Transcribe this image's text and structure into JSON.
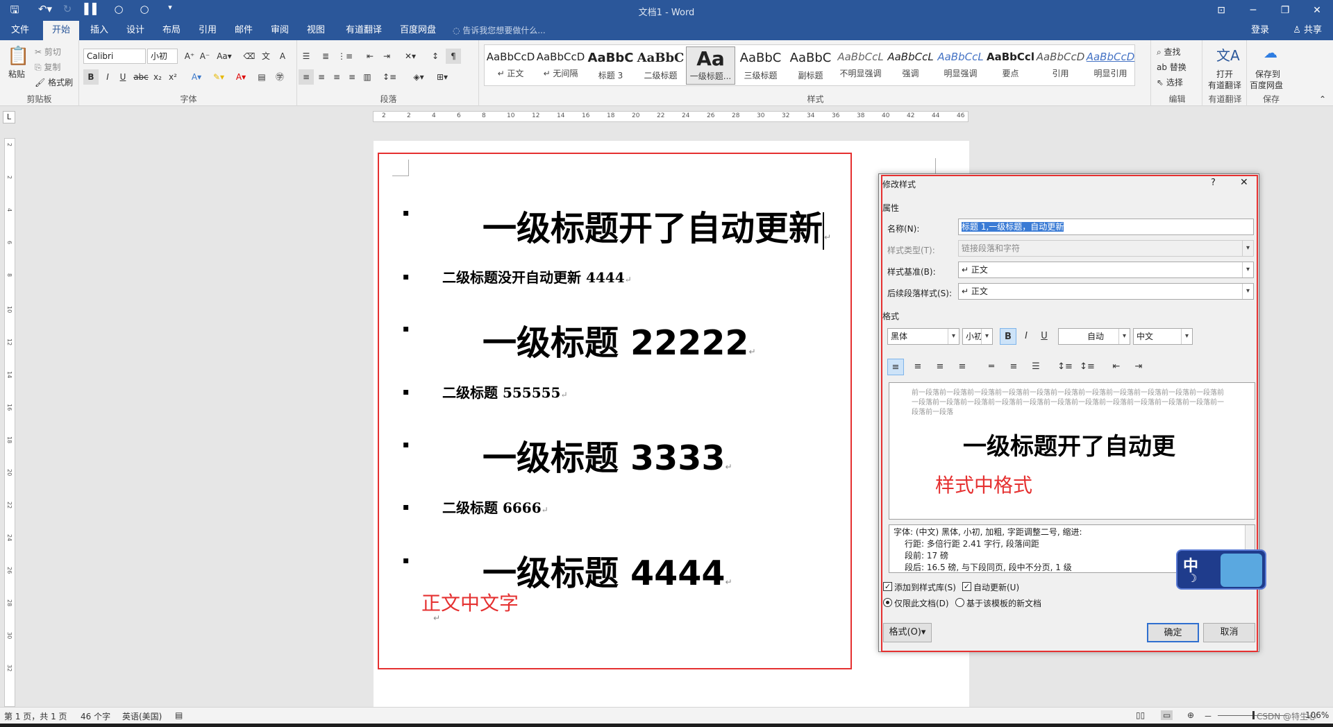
{
  "titlebar": {
    "title": "文档1 - Word",
    "qa_icons": [
      "save-icon",
      "undo-icon",
      "redo-icon",
      "chart-icon",
      "circle-icon",
      "circle-icon",
      "customize-icon"
    ]
  },
  "tabs": [
    "文件",
    "开始",
    "插入",
    "设计",
    "布局",
    "引用",
    "邮件",
    "审阅",
    "视图",
    "有道翻译",
    "百度网盘"
  ],
  "active_tab": "开始",
  "tellme_placeholder": "告诉我您想要做什么...",
  "login": "登录",
  "share": "共享",
  "ribbon": {
    "clipboard": {
      "paste": "粘贴",
      "cut": "剪切",
      "copy": "复制",
      "format_painter": "格式刷",
      "label": "剪贴板"
    },
    "font": {
      "name": "Calibri",
      "size": "小初",
      "label": "字体"
    },
    "paragraph": {
      "label": "段落"
    },
    "styles": {
      "label": "样式",
      "items": [
        {
          "preview": "AaBbCcD",
          "name": "↵ 正文"
        },
        {
          "preview": "AaBbCcD",
          "name": "↵ 无间隔"
        },
        {
          "preview": "AaBbC",
          "name": "标题 3"
        },
        {
          "preview": "AaBbC",
          "name": "二级标题"
        },
        {
          "preview": "Aa",
          "name": "一级标题..."
        },
        {
          "preview": "AaBbC",
          "name": "三级标题"
        },
        {
          "preview": "AaBbC",
          "name": "副标题"
        },
        {
          "preview": "AaBbCcL",
          "name": "不明显强调"
        },
        {
          "preview": "AaBbCcL",
          "name": "强调"
        },
        {
          "preview": "AaBbCcL",
          "name": "明显强调"
        },
        {
          "preview": "AaBbCcl",
          "name": "要点"
        },
        {
          "preview": "AaBbCcD",
          "name": "引用"
        },
        {
          "preview": "AaBbCcD",
          "name": "明显引用"
        }
      ]
    },
    "editing": {
      "find": "查找",
      "replace": "替换",
      "select": "选择",
      "label": "编辑"
    },
    "youdao": {
      "line1": "打开",
      "line2": "有道翻译",
      "label": "有道翻译"
    },
    "baidu": {
      "line1": "保存到",
      "line2": "百度网盘",
      "label": "保存"
    }
  },
  "ruler": {
    "marks": [
      "2",
      "2",
      "4",
      "6",
      "8",
      "10",
      "12",
      "14",
      "16",
      "18",
      "20",
      "22",
      "24",
      "26",
      "28",
      "30",
      "32",
      "34",
      "36",
      "38",
      "40",
      "42",
      "44",
      "46"
    ],
    "vmarks": [
      "2",
      "2",
      "4",
      "6",
      "8",
      "10",
      "12",
      "14",
      "16",
      "18",
      "20",
      "22",
      "24",
      "26",
      "28",
      "30",
      "32"
    ]
  },
  "document": {
    "lines": [
      {
        "level": 1,
        "text": "一级标题开了自动更新"
      },
      {
        "level": 2,
        "text": "二级标题没开自动更新 4444"
      },
      {
        "level": 1,
        "text": "一级标题 22222"
      },
      {
        "level": 2,
        "text": "二级标题 555555"
      },
      {
        "level": 1,
        "text": "一级标题 3333"
      },
      {
        "level": 2,
        "text": "二级标题 6666"
      },
      {
        "level": 1,
        "text": "一级标题 4444"
      }
    ],
    "annotation": "正文中文字",
    "paragraph_mark": "↵"
  },
  "dialog": {
    "title": "修改样式",
    "help": "?",
    "close": "✕",
    "properties_label": "属性",
    "name_label": "名称(N):",
    "name_value": "标题 1,一级标题，自动更新",
    "type_label": "样式类型(T):",
    "type_value": "链接段落和字符",
    "based_label": "样式基准(B):",
    "based_value": "↵ 正文",
    "next_label": "后续段落样式(S):",
    "next_value": "↵ 正文",
    "format_label": "格式",
    "font_value": "黑体",
    "size_value": "小初",
    "color_value": "自动",
    "lang_value": "中文",
    "preview_prev": "前一段落前一段落前一段落前一段落前一段落前一段落前一段落前一段落前一段落前一段落前一段落前一段落前一段落前一段落前一段落前一段落前一段落前一段落前一段落前一段落前一段落前一段落前一段落前一段落",
    "preview_text": "一级标题开了自动更",
    "annotation": "样式中格式",
    "desc_lines": [
      "字体: (中文) 黑体, 小初, 加粗, 字距调整二号, 缩进:",
      "行距: 多倍行距 2.41 字行, 段落间距",
      "段前: 17 磅",
      "段后: 16.5 磅, 与下段同页, 段中不分页, 1 级"
    ],
    "add_to_gallery": "添加到样式库(S)",
    "auto_update": "自动更新(U)",
    "only_doc": "仅限此文档(D)",
    "new_docs": "基于该模板的新文档",
    "format_button": "格式(O)▾",
    "ok": "确定",
    "cancel": "取消"
  },
  "ime": {
    "label": "中"
  },
  "statusbar": {
    "page": "第 1 页，共 1 页",
    "words": "46 个字",
    "lang": "英语(美国)",
    "zoom": "106%",
    "watermark": "CSDN @特生心"
  },
  "colors": {
    "accent": "#2b579a",
    "annotation": "#e53030"
  }
}
